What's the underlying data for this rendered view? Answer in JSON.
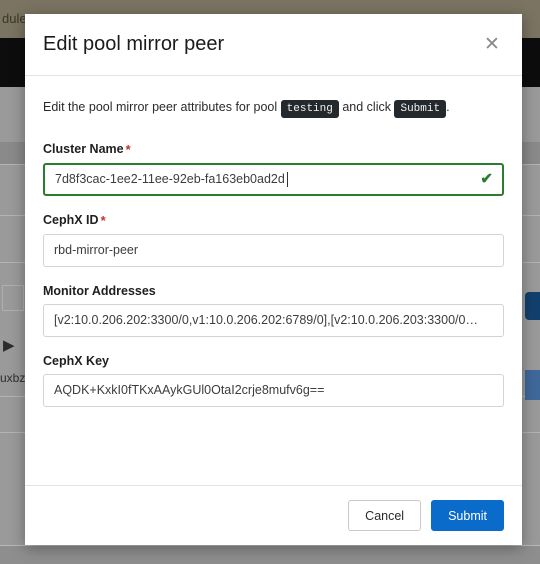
{
  "background": {
    "top_text": "dule.",
    "side_text": "uxbz-",
    "arrow_icon": "▶"
  },
  "modal": {
    "title": "Edit pool mirror peer",
    "close_icon": "✕",
    "intro": {
      "prefix": "Edit the pool mirror peer attributes for pool",
      "pool_badge": "testing",
      "middle": "and click",
      "action_badge": "Submit",
      "suffix": "."
    },
    "fields": [
      {
        "label": "Cluster Name",
        "required": "*",
        "value": "7d8f3cac-1ee2-11ee-92eb-fa163eb0ad2d",
        "valid_icon": "✔"
      },
      {
        "label": "CephX ID",
        "required": "*",
        "value": "rbd-mirror-peer"
      },
      {
        "label": "Monitor Addresses",
        "value": "[v2:10.0.206.202:3300/0,v1:10.0.206.202:6789/0],[v2:10.0.206.203:3300/0…"
      },
      {
        "label": "CephX Key",
        "value": "AQDK+KxkI0fTKxAAykGUl0OtaI2crje8mufv6g=="
      }
    ],
    "footer": {
      "cancel_label": "Cancel",
      "submit_label": "Submit"
    }
  },
  "colors": {
    "accent": "#0b6bcb",
    "valid": "#2a7d2e",
    "required": "#c9302c",
    "badge_bg": "#24292e"
  }
}
